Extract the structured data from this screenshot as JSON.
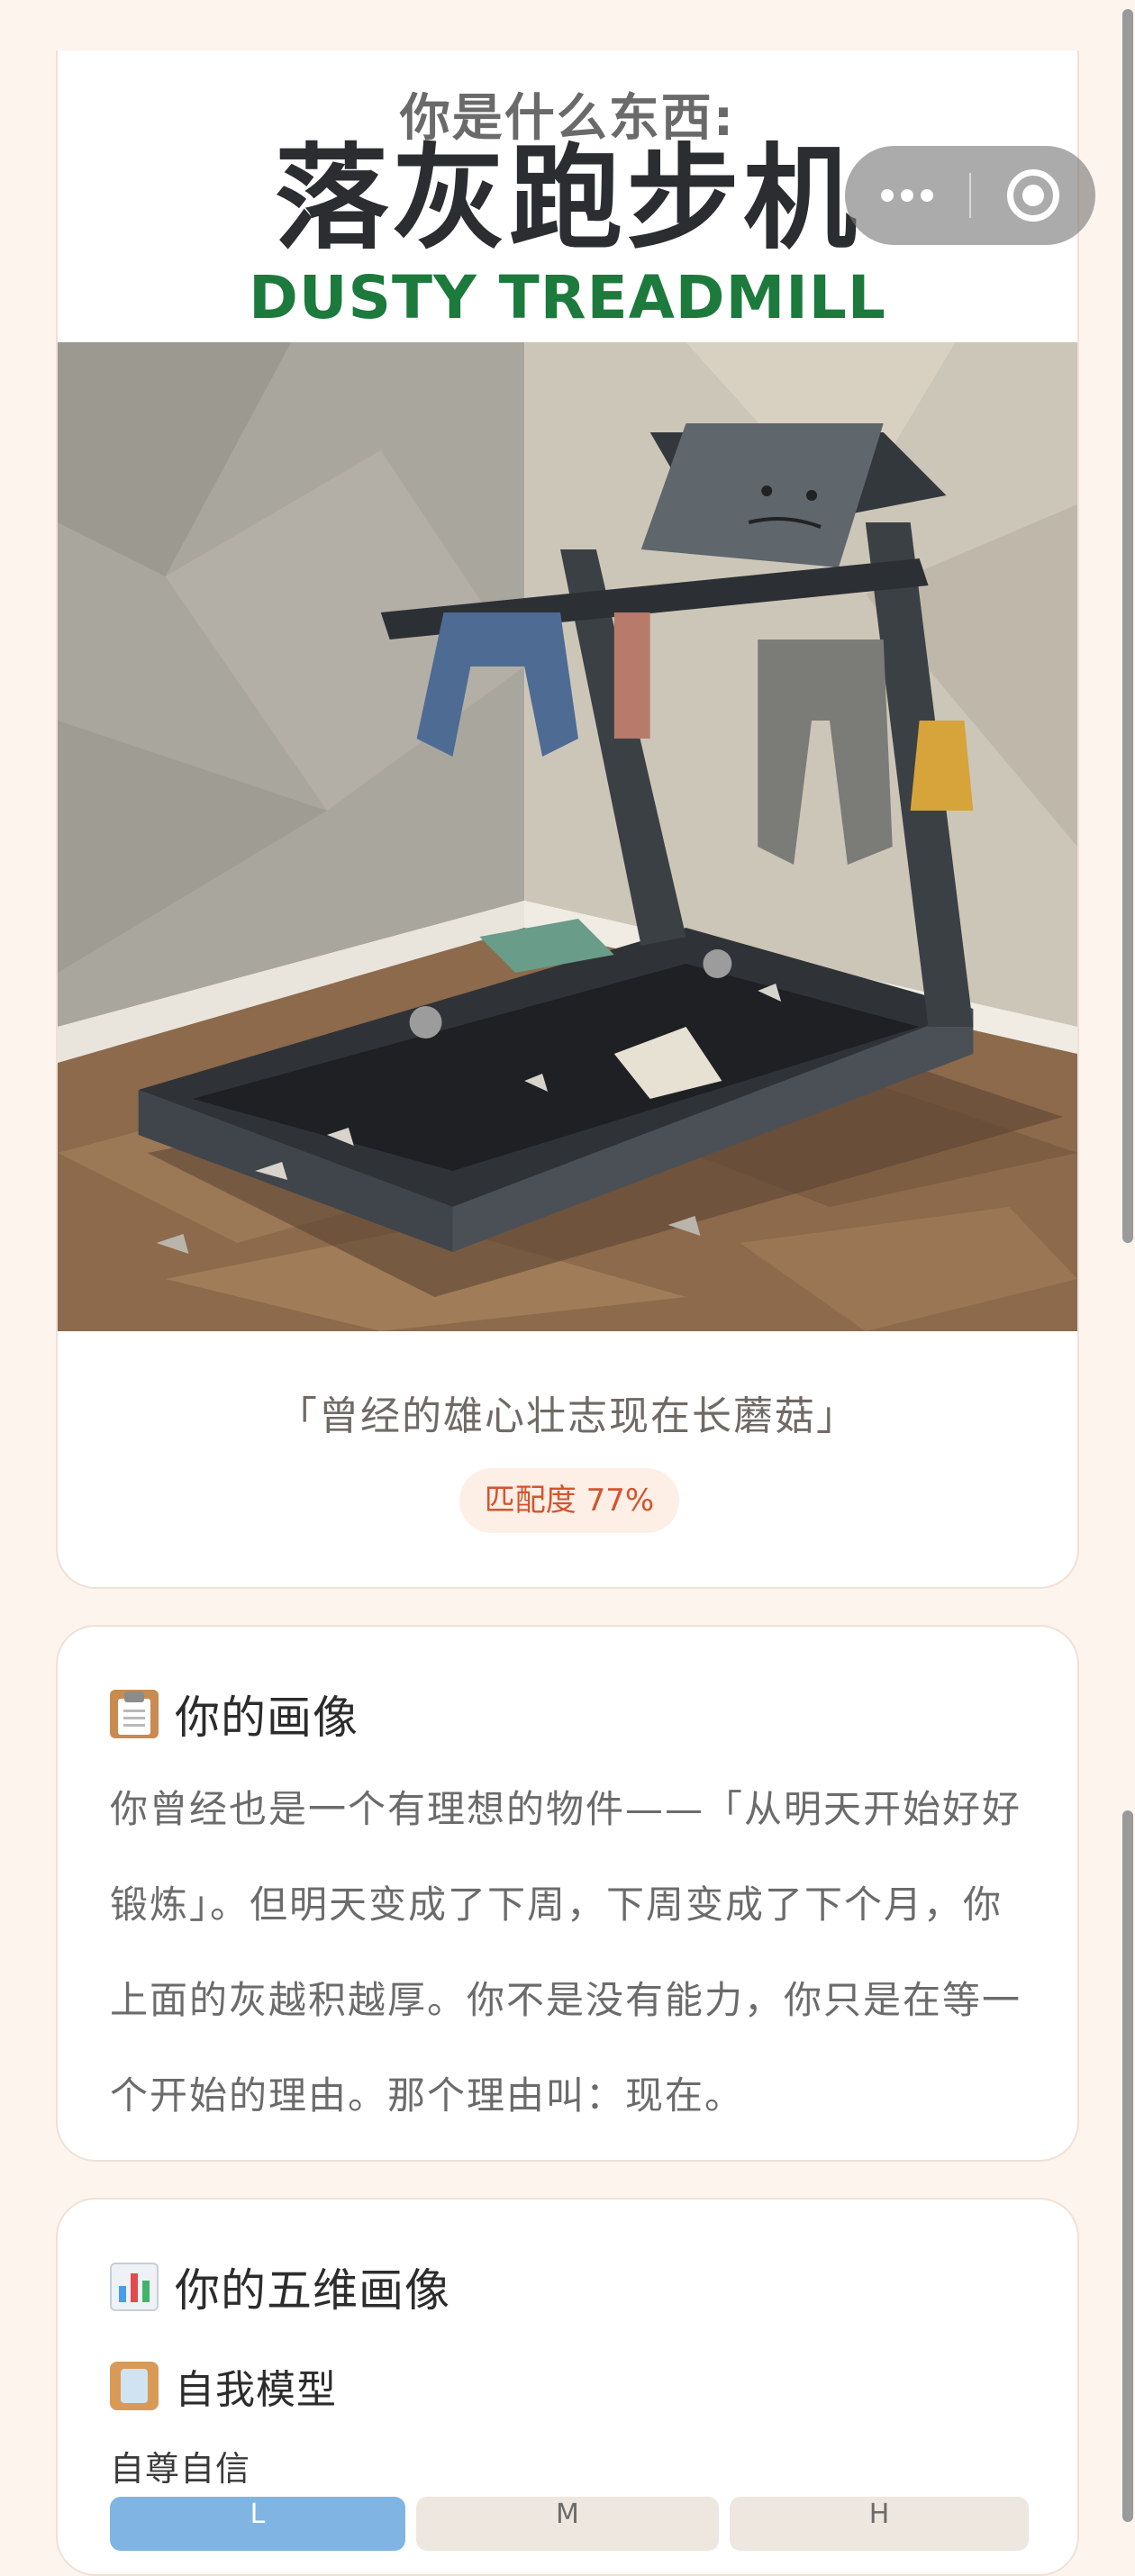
{
  "result": {
    "eyebrow": "你是什么东西:",
    "title_cn": "落灰跑步机",
    "title_en": "DUSTY TREADMILL",
    "quote": "「曾经的雄心壮志现在长蘑菇」",
    "match_label": "匹配度 77%",
    "match_value": 77
  },
  "portrait": {
    "icon": "clipboard-icon",
    "title": "你的画像",
    "body": "你曾经也是一个有理想的物件——「从明天开始好好锻炼」。但明天变成了下周，下周变成了下个月，你上面的灰越积越厚。你不是没有能力，你只是在等一个开始的理由。那个理由叫：现在。"
  },
  "dimensions": {
    "icon": "bar-chart-icon",
    "title": "你的五维画像",
    "model": {
      "icon": "mirror-icon",
      "title": "自我模型"
    },
    "first_dimension": {
      "label": "自尊自信",
      "levels": [
        "L",
        "M",
        "H"
      ],
      "selected": "L"
    }
  },
  "capsule": {
    "more_icon": "more-dots-icon",
    "close_icon": "close-circle-icon"
  },
  "colors": {
    "page_bg": "#fdf4ee",
    "title_green": "#1c7a3d",
    "match_orange": "#d4542c",
    "level_active": "#80b5e3"
  }
}
